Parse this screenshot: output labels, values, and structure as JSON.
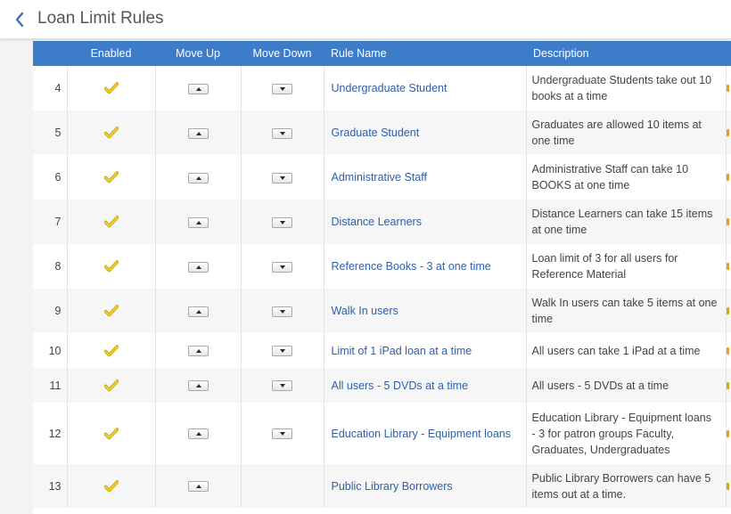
{
  "page": {
    "title": "Loan Limit Rules"
  },
  "table": {
    "columns": {
      "number": "",
      "enabled": "Enabled",
      "move_up": "Move Up",
      "move_down": "Move Down",
      "rule_name": "Rule Name",
      "description": "Description"
    },
    "rows": [
      {
        "num": "4",
        "enabled": true,
        "name": "Undergraduate Student",
        "description": "Undergraduate Students take out 10 books at a time",
        "has_move_down": true
      },
      {
        "num": "5",
        "enabled": true,
        "name": "Graduate Student",
        "description": "Graduates are allowed 10 items at one time",
        "has_move_down": true
      },
      {
        "num": "6",
        "enabled": true,
        "name": "Administrative Staff",
        "description": "Administrative Staff can take 10 BOOKS at one time",
        "has_move_down": true
      },
      {
        "num": "7",
        "enabled": true,
        "name": "Distance Learners",
        "description": "Distance Learners can take 15 items at one time",
        "has_move_down": true
      },
      {
        "num": "8",
        "enabled": true,
        "name": "Reference Books - 3 at one time",
        "description": "Loan limit of 3 for all users for Reference Material",
        "has_move_down": true
      },
      {
        "num": "9",
        "enabled": true,
        "name": "Walk In users",
        "description": "Walk In users can take 5 items at one time",
        "has_move_down": true
      },
      {
        "num": "10",
        "enabled": true,
        "name": "Limit of 1 iPad loan at a time",
        "description": "All users can take 1 iPad at a time",
        "has_move_down": true
      },
      {
        "num": "11",
        "enabled": true,
        "name": "All users - 5 DVDs at a time",
        "description": "All users - 5 DVDs at a time",
        "has_move_down": true
      },
      {
        "num": "12",
        "enabled": true,
        "name": "Education Library - Equipment loans",
        "description": "Education Library - Equipment loans - 3 for patron groups Faculty, Graduates, Undergraduates",
        "has_move_down": true
      },
      {
        "num": "13",
        "enabled": true,
        "name": "Public Library Borrowers",
        "description": "Public Library Borrowers can have 5 items out at a time.",
        "has_move_down": false
      }
    ]
  },
  "icons": {
    "back": "chevron-left-icon",
    "enabled": "checkmark-icon",
    "move_up": "arrow-up-icon",
    "move_down": "arrow-down-icon"
  },
  "colors": {
    "header_bg": "#3d7cc9",
    "link": "#2e5fa8",
    "check": "#f2cc1e",
    "row_alt": "#f6f6f6"
  }
}
